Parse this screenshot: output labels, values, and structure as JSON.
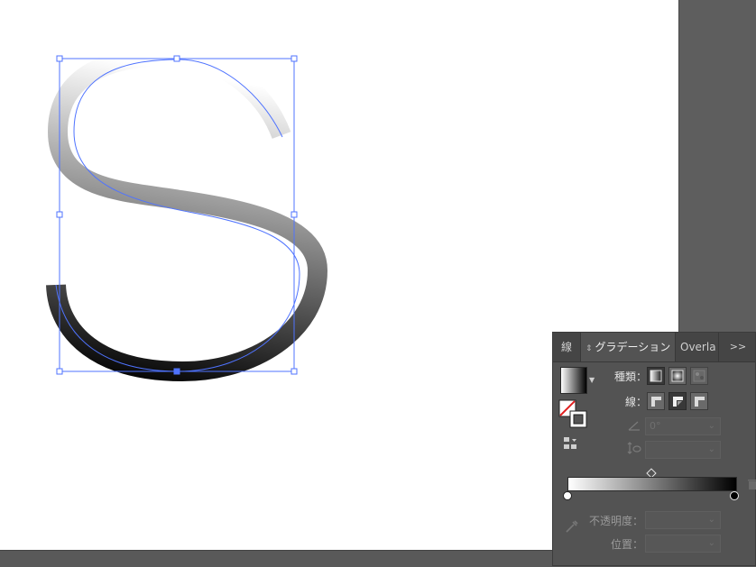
{
  "canvas": {
    "background": "#ffffff",
    "path_color": "#4f73ff"
  },
  "panel": {
    "tabs": {
      "stroke": "線",
      "gradient": "グラデーション",
      "overlay": "Overla",
      "more": ">>"
    },
    "type_label": "種類：",
    "stroke_label": "線：",
    "angle_value": "0°",
    "opacity_label": "不透明度：",
    "position_label": "位置："
  },
  "icons": {
    "gradient_types": [
      "linear-gradient-icon",
      "radial-gradient-icon",
      "freeform-gradient-icon"
    ],
    "stroke_modes": [
      "stroke-within-icon",
      "stroke-along-icon",
      "stroke-across-icon"
    ]
  },
  "gradient": {
    "start_color": "#ffffff",
    "end_color": "#000000",
    "midpoint": 0.5
  }
}
